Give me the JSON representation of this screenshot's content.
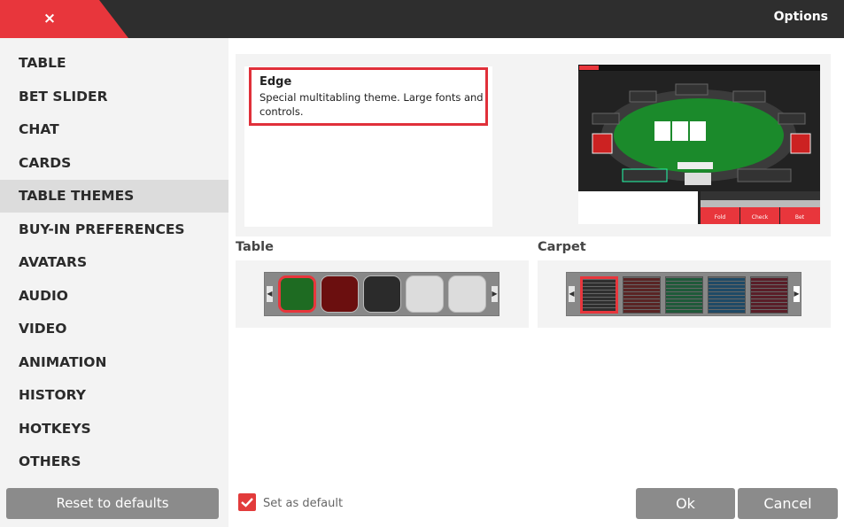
{
  "header": {
    "close_symbol": "×",
    "title": "Options"
  },
  "sidebar": {
    "items": [
      {
        "label": "TABLE"
      },
      {
        "label": "BET SLIDER"
      },
      {
        "label": "CHAT"
      },
      {
        "label": "CARDS"
      },
      {
        "label": "TABLE THEMES",
        "active": true
      },
      {
        "label": "BUY-IN PREFERENCES"
      },
      {
        "label": "AVATARS"
      },
      {
        "label": "AUDIO"
      },
      {
        "label": "VIDEO"
      },
      {
        "label": "ANIMATION"
      },
      {
        "label": "HISTORY"
      },
      {
        "label": "HOTKEYS"
      },
      {
        "label": "OTHERS"
      }
    ],
    "reset_label": "Reset to defaults"
  },
  "theme": {
    "name": "Edge",
    "description": "Special multitabling theme. Large fonts and controls.",
    "preview_buttons": [
      "Fold",
      "Check",
      "Bet"
    ]
  },
  "table_section": {
    "label": "Table",
    "swatches": [
      {
        "color": "#1e6b22",
        "selected": true
      },
      {
        "color": "#6b0f0f"
      },
      {
        "color": "#2b2b2b"
      },
      {
        "color": "#dcdcdc"
      },
      {
        "color": "#dcdcdc"
      }
    ]
  },
  "carpet_section": {
    "label": "Carpet",
    "swatches": [
      {
        "color": "#2f2f2f",
        "selected": true
      },
      {
        "color": "#5a2424"
      },
      {
        "color": "#1f5a3a"
      },
      {
        "color": "#1f4a66"
      },
      {
        "color": "#5a1e28"
      }
    ]
  },
  "footer": {
    "set_default_label": "Set as default",
    "set_default_checked": true,
    "ok_label": "Ok",
    "cancel_label": "Cancel"
  },
  "colors": {
    "accent": "#e8363c",
    "header_bg": "#2e2e2e",
    "button_bg": "#8b8b8b",
    "felt": "#1b8a2b"
  }
}
